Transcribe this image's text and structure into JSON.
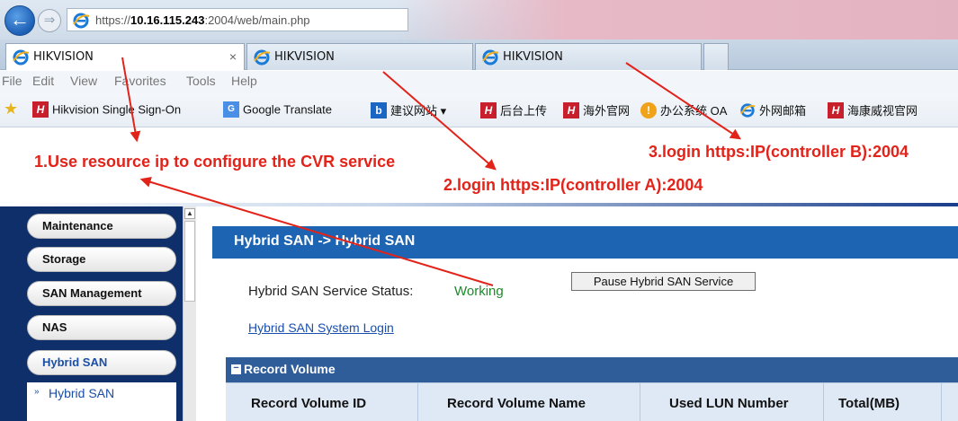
{
  "browser": {
    "url_prefix": "https://",
    "url_host": "10.16.115.243",
    "url_rest": ":2004/web/main.php",
    "tabs": [
      {
        "label": "HIKVISION",
        "active": true,
        "close": "×"
      },
      {
        "label": "HIKVISION",
        "active": false
      },
      {
        "label": "HIKVISION",
        "active": false
      }
    ],
    "menu": [
      "File",
      "Edit",
      "View",
      "Favorites",
      "Tools",
      "Help"
    ],
    "favorites": [
      {
        "label": "Hikvision Single Sign-On",
        "icon": "hikvision-icon"
      },
      {
        "label": "Google Translate",
        "icon": "google-translate-icon"
      },
      {
        "label": "建议网站 ▾",
        "icon": "suggested-sites-icon"
      },
      {
        "label": "后台上传",
        "icon": "hikvision-icon"
      },
      {
        "label": "海外官网",
        "icon": "hikvision-icon"
      },
      {
        "label": "办公系统 OA",
        "icon": "oa-icon"
      },
      {
        "label": "外网邮箱",
        "icon": "ie-icon"
      },
      {
        "label": "海康威视官网",
        "icon": "hikvision-icon"
      }
    ]
  },
  "annotations": {
    "step1": "1.Use resource ip to configure the CVR service",
    "step2": "2.login https:IP(controller A):2004",
    "step3": "3.login https:IP(controller B):2004",
    "color": "#e2231a"
  },
  "sidebar": {
    "items": [
      "Maintenance",
      "Storage",
      "SAN Management",
      "NAS",
      "Hybrid SAN"
    ],
    "active": "Hybrid SAN",
    "sub_marker": "»",
    "sub_item": "Hybrid SAN"
  },
  "main": {
    "breadcrumb": "Hybrid SAN -> Hybrid SAN",
    "status_label": "Hybrid SAN Service Status:",
    "status_value": "Working",
    "pause_button": "Pause Hybrid SAN Service",
    "system_login": "Hybrid SAN System Login",
    "panel": {
      "title": "Record Volume",
      "toggle": "−",
      "columns": [
        "Record Volume ID",
        "Record Volume Name",
        "Used LUN Number",
        "Total(MB)"
      ]
    }
  }
}
